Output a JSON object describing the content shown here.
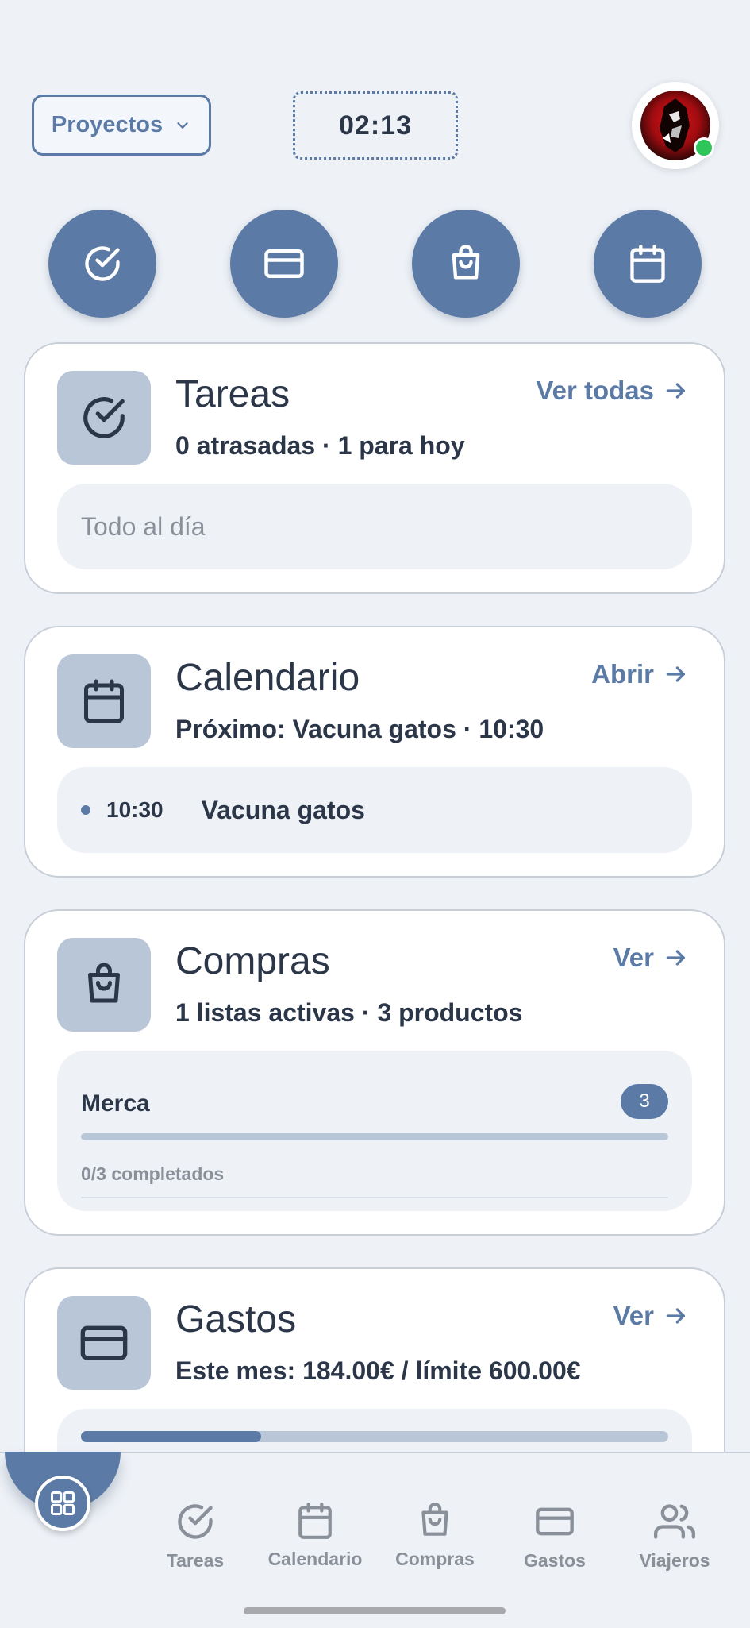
{
  "header": {
    "projects_label": "Proyectos",
    "timer": "02:13"
  },
  "quick_actions": [
    {
      "icon": "check-circle-icon"
    },
    {
      "icon": "credit-card-icon"
    },
    {
      "icon": "shopping-bag-icon"
    },
    {
      "icon": "calendar-icon"
    }
  ],
  "tasks_card": {
    "title": "Tareas",
    "link": "Ver todas",
    "summary": "0 atrasadas · 1 para hoy",
    "empty_state": "Todo al día"
  },
  "calendar_card": {
    "title": "Calendario",
    "link": "Abrir",
    "summary": "Próximo: Vacuna gatos · 10:30",
    "event": {
      "time": "10:30",
      "name": "Vacuna gatos"
    }
  },
  "shopping_card": {
    "title": "Compras",
    "link": "Ver",
    "summary": "1 listas activas · 3 productos",
    "list": {
      "name": "Merca",
      "count": "3",
      "progress_text": "0/3 completados",
      "progress": 0
    }
  },
  "expenses_card": {
    "title": "Gastos",
    "link": "Ver",
    "summary": "Este mes: 184.00€ / límite 600.00€",
    "spent": 184.0,
    "limit": 600.0
  },
  "bottom_nav": [
    {
      "label": "Tareas",
      "icon": "check-circle-icon"
    },
    {
      "label": "Calendario",
      "icon": "calendar-icon"
    },
    {
      "label": "Compras",
      "icon": "shopping-bag-icon"
    },
    {
      "label": "Gastos",
      "icon": "credit-card-icon"
    },
    {
      "label": "Viajeros",
      "icon": "users-icon"
    }
  ],
  "colors": {
    "accent": "#5b7aa5",
    "background": "#eef2f7",
    "text": "#2b3648",
    "status_online": "#2ec55a"
  }
}
